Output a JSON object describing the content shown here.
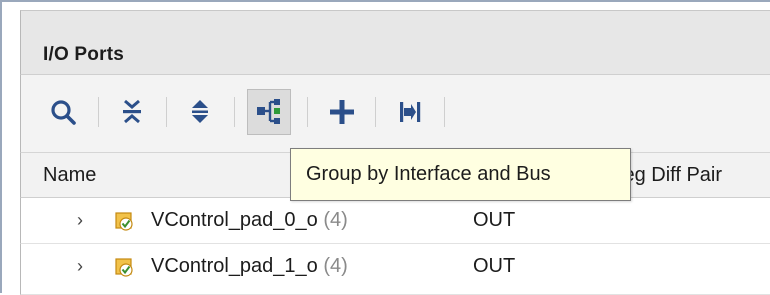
{
  "panel": {
    "title": "I/O Ports"
  },
  "toolbar": {
    "buttons": [
      {
        "name": "search",
        "icon": "search-icon",
        "tooltip": ""
      },
      {
        "name": "collapse-all",
        "icon": "collapse-all-icon",
        "tooltip": ""
      },
      {
        "name": "expand-all",
        "icon": "expand-all-icon",
        "tooltip": ""
      },
      {
        "name": "group-by-interface-and-bus",
        "icon": "group-by-icon",
        "pressed": true
      },
      {
        "name": "add",
        "icon": "plus-icon"
      },
      {
        "name": "auto-assign",
        "icon": "auto-assign-icon"
      }
    ]
  },
  "table": {
    "columns": [
      "Name",
      "",
      "Neg Diff Pair"
    ],
    "rows": [
      {
        "name": "VControl_pad_0_o",
        "count": "(4)",
        "direction": "OUT",
        "neg_diff_pair": ""
      },
      {
        "name": "VControl_pad_1_o",
        "count": "(4)",
        "direction": "OUT",
        "neg_diff_pair": ""
      }
    ]
  },
  "tooltip": {
    "text": "Group by Interface and Bus"
  },
  "colors": {
    "icon_blue": "#2b4f8a",
    "tooltip_bg": "#ffffe1",
    "port_icon_orange": "#e8a020",
    "port_icon_green": "#3b8f2f"
  }
}
